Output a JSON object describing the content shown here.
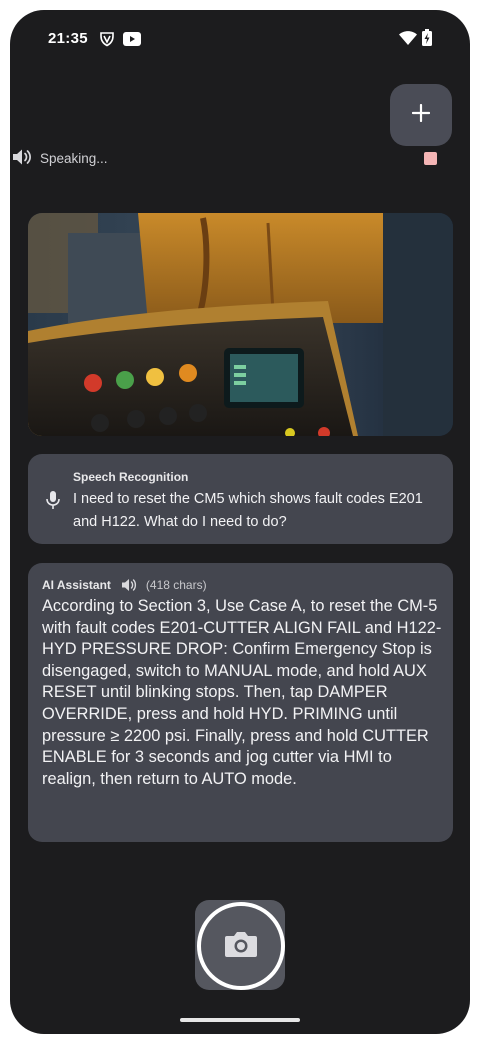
{
  "status_bar": {
    "time": "21:35"
  },
  "speaking_indicator": {
    "label": "Speaking..."
  },
  "speech_recognition": {
    "title": "Speech Recognition",
    "text": "I need to reset the CM5 which shows fault codes E201 and H122. What do I need to do?"
  },
  "ai_assistant": {
    "title": "AI Assistant",
    "char_count": "(418 chars)",
    "response": "According to Section 3, Use Case A, to reset the CM-5 with fault codes E201-CUTTER ALIGN FAIL and H122-HYD PRESSURE DROP: Confirm Emergency Stop is disengaged, switch to MANUAL mode, and hold AUX RESET until blinking stops. Then, tap DAMPER OVERRIDE, press and hold HYD. PRIMING until pressure ≥ 2200 psi. Finally, press and hold CUTTER ENABLE for 3 seconds and jog cutter via HMI to realign, then return to AUTO mode."
  },
  "colors": {
    "background": "#1c1c1e",
    "card": "#44464f",
    "fab": "#4a4c56",
    "stop_indicator": "#f4b5b5"
  },
  "icons": {
    "add": "plus-icon",
    "speaker": "volume-icon",
    "mic": "microphone-icon",
    "camera": "camera-icon"
  }
}
